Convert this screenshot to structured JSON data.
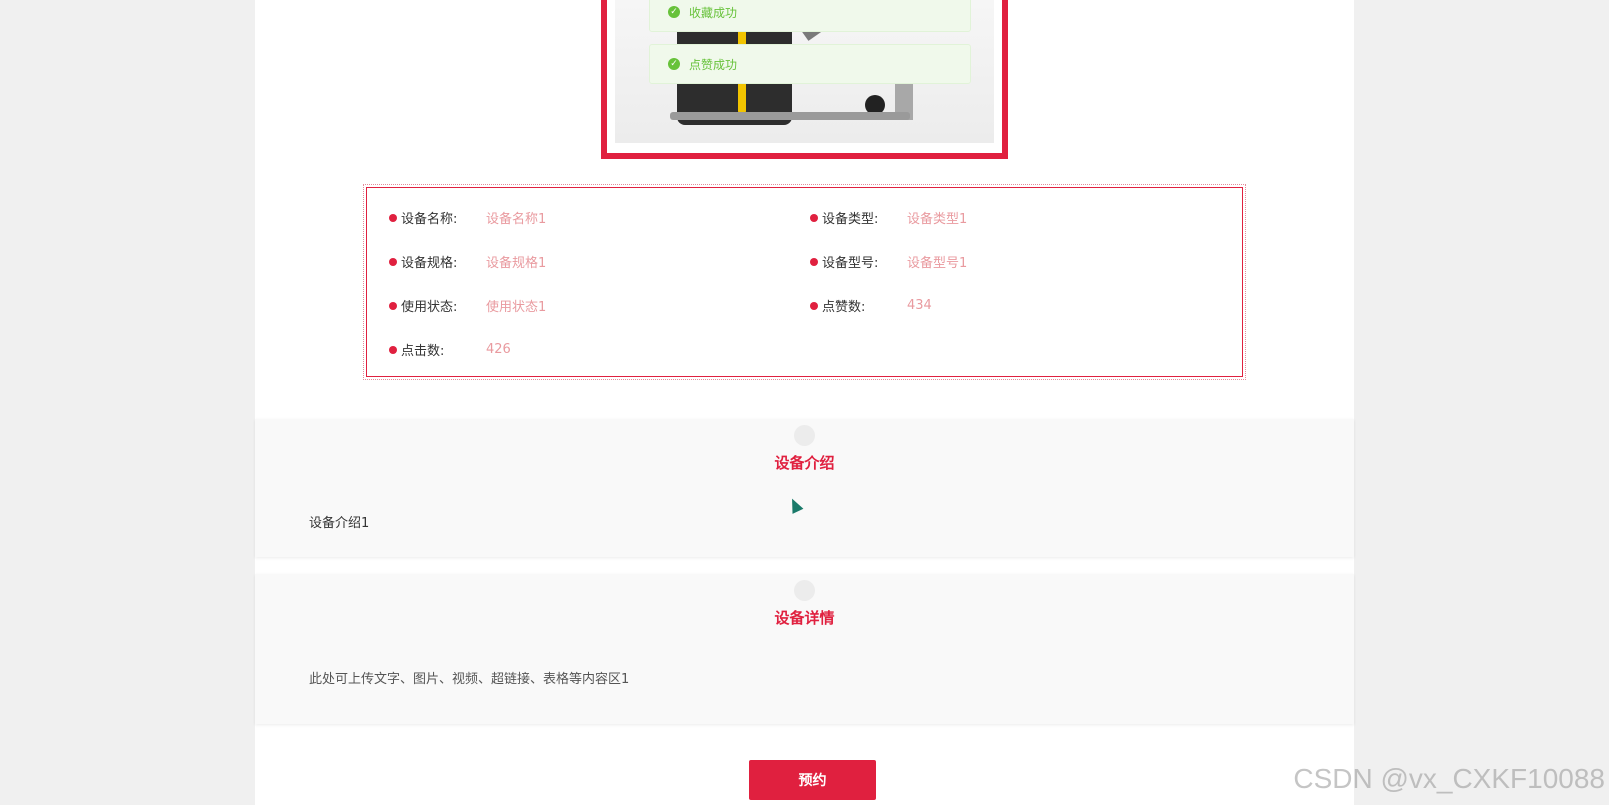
{
  "toasts": [
    {
      "text": "收藏成功"
    },
    {
      "text": "点赞成功"
    }
  ],
  "info": {
    "items": [
      {
        "label": "设备名称:",
        "value": "设备名称1"
      },
      {
        "label": "设备类型:",
        "value": "设备类型1"
      },
      {
        "label": "设备规格:",
        "value": "设备规格1"
      },
      {
        "label": "设备型号:",
        "value": "设备型号1"
      },
      {
        "label": "使用状态:",
        "value": "使用状态1"
      },
      {
        "label": "点赞数:",
        "value": "434"
      },
      {
        "label": "点击数:",
        "value": "426"
      }
    ]
  },
  "intro": {
    "title": "设备介绍",
    "body": "设备介绍1"
  },
  "detail": {
    "title": "设备详情",
    "body": "此处可上传文字、图片、视频、超链接、表格等内容区1"
  },
  "actions": {
    "book_label": "预约"
  },
  "watermark": "CSDN @vx_CXKF10088",
  "colors": {
    "accent": "#e0203f",
    "success": "#67c23a",
    "value_text": "#e99a9f"
  }
}
